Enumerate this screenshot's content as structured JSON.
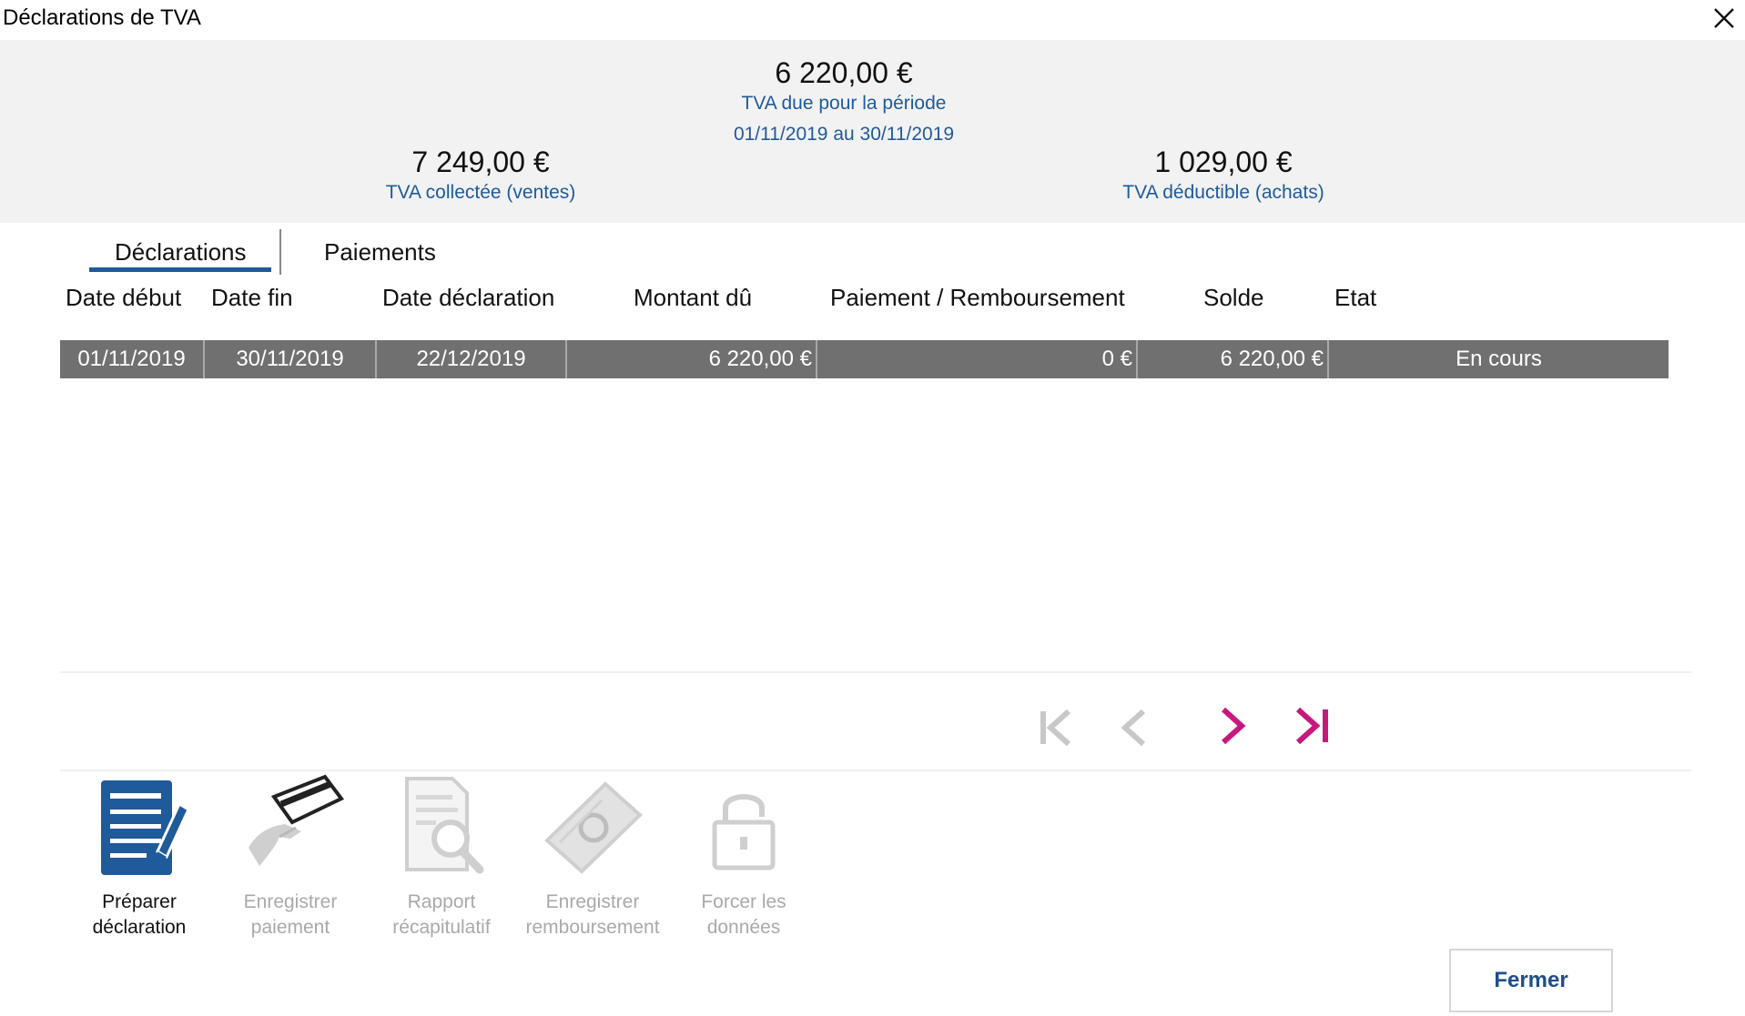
{
  "window": {
    "title": "Déclarations de TVA"
  },
  "summary": {
    "due_amount": "6 220,00 €",
    "due_label": "TVA due pour la période",
    "period": "01/11/2019 au 30/11/2019",
    "collected_amount": "7 249,00 €",
    "collected_label": "TVA collectée (ventes)",
    "deductible_amount": "1 029,00 €",
    "deductible_label": "TVA déductible (achats)"
  },
  "tabs": [
    {
      "label": "Déclarations",
      "active": true
    },
    {
      "label": "Paiements",
      "active": false
    }
  ],
  "table": {
    "columns": [
      "Date début",
      "Date fin",
      "Date déclaration",
      "Montant dû",
      "Paiement / Remboursement",
      "Solde",
      "Etat"
    ],
    "rows": [
      [
        "01/11/2019",
        "30/11/2019",
        "22/12/2019",
        "6 220,00 €",
        "0 €",
        "6 220,00 €",
        "En cours"
      ]
    ]
  },
  "pager": [
    {
      "icon": "first-page-icon",
      "enabled": false
    },
    {
      "icon": "previous-page-icon",
      "enabled": false
    },
    {
      "icon": "next-page-icon",
      "enabled": true
    },
    {
      "icon": "last-page-icon",
      "enabled": true
    }
  ],
  "actions": [
    {
      "label": "Préparer\ndéclaration",
      "icon": "document-pen-icon",
      "enabled": true
    },
    {
      "label": "Enregistrer\npaiement",
      "icon": "card-hand-icon",
      "enabled": false
    },
    {
      "label": "Rapport\nrécapitulatif",
      "icon": "report-search-icon",
      "enabled": false
    },
    {
      "label": "Enregistrer\nremboursement",
      "icon": "banknote-icon",
      "enabled": false
    },
    {
      "label": "Forcer les\ndonnées",
      "icon": "unlock-icon",
      "enabled": false
    }
  ],
  "footer": {
    "close_label": "Fermer"
  },
  "colors": {
    "accent_blue": "#1f5a9a",
    "pager_magenta": "#c8187e",
    "row_selected": "#707070",
    "disabled_gray": "#c8c8c8"
  }
}
